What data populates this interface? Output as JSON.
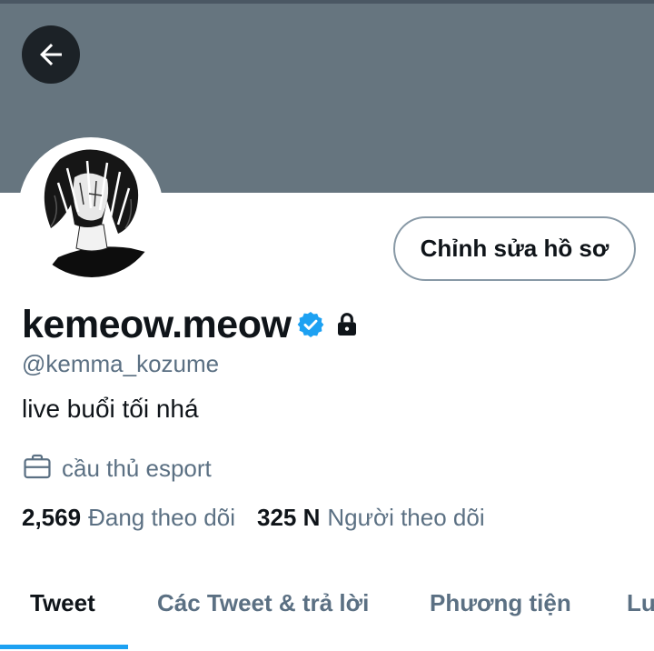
{
  "header": {
    "back_icon": "arrow-left-icon"
  },
  "profile": {
    "display_name": "kemeow.meow",
    "verified_icon": "verified-badge-icon",
    "lock_icon": "lock-icon",
    "handle": "@kemma_kozume",
    "bio": "live buổi tối nhá",
    "job_icon": "briefcase-icon",
    "job": "cầu thủ esport",
    "edit_button_label": "Chỉnh sửa hồ sơ"
  },
  "stats": {
    "following_count": "2,569",
    "following_label": "Đang theo dõi",
    "followers_count": "325 N",
    "followers_label": "Người theo dõi"
  },
  "tabs": [
    {
      "label": "Tweet",
      "active": true
    },
    {
      "label": "Các Tweet & trả lời",
      "active": false
    },
    {
      "label": "Phương tiện",
      "active": false
    },
    {
      "label": "Lượt thích",
      "active": false
    }
  ],
  "colors": {
    "banner": "#66757f",
    "accent": "#1da1f2",
    "secondary_text": "#5b7083",
    "verified": "#1da1f2"
  }
}
